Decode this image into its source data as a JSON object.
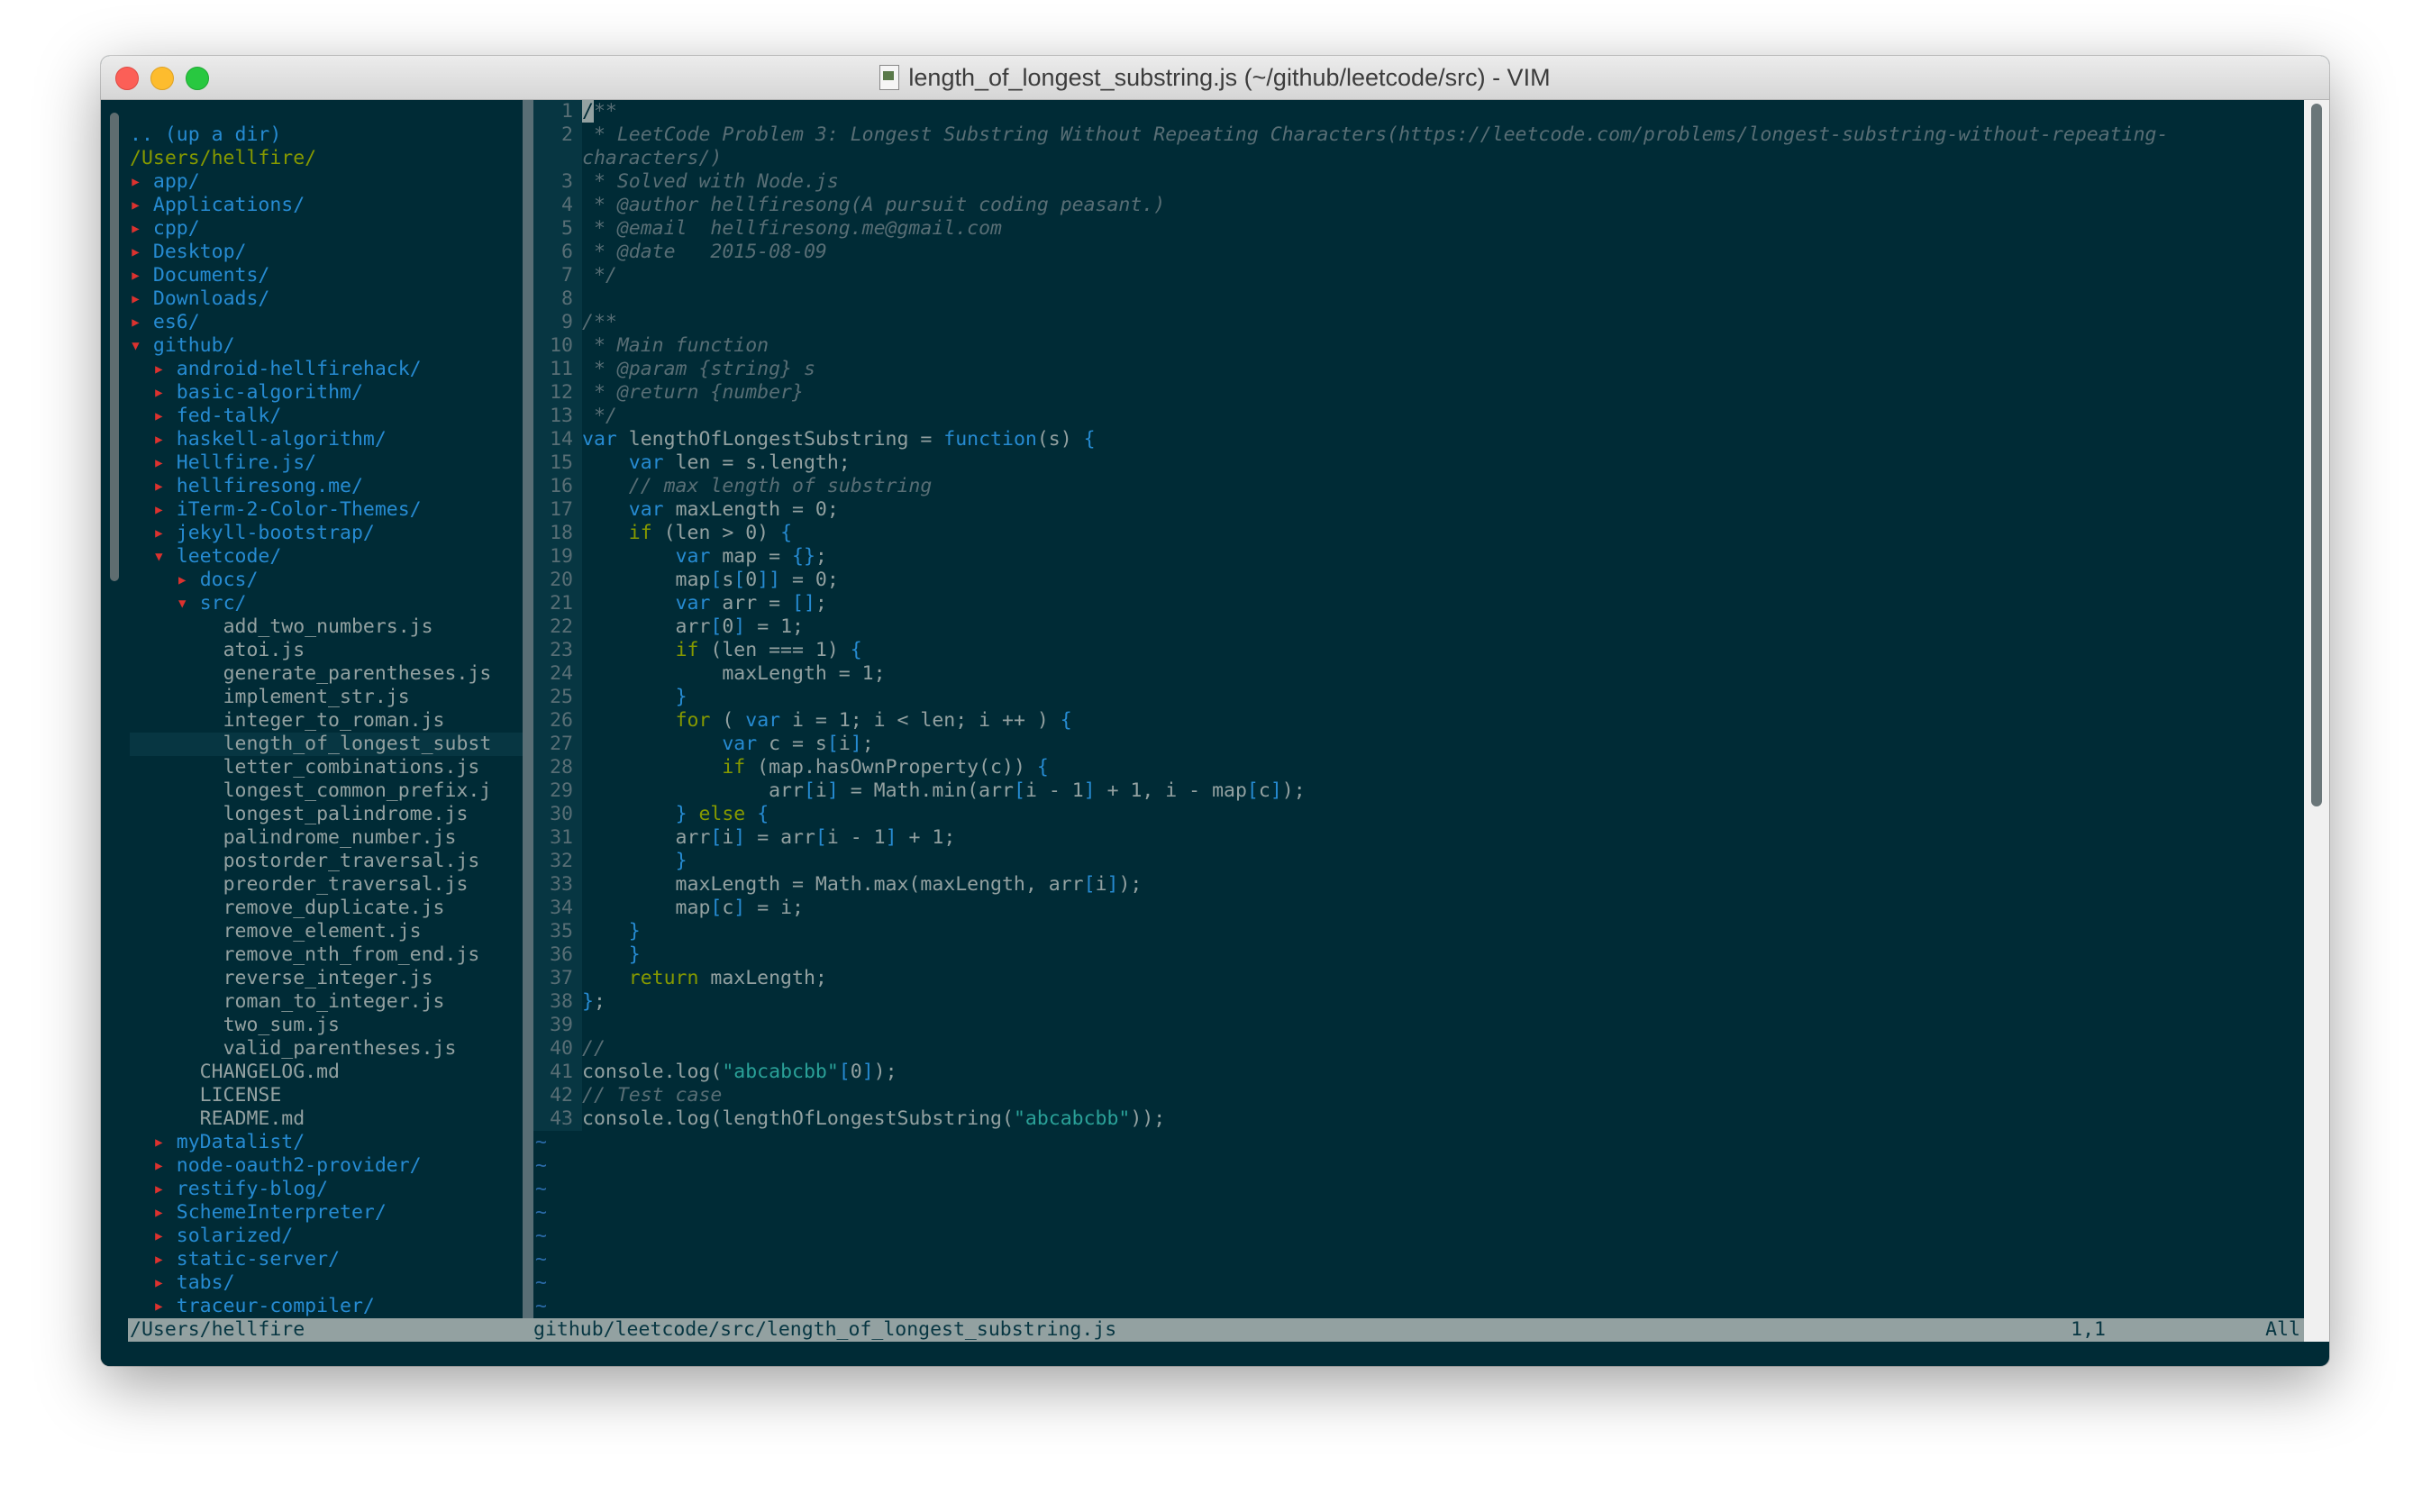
{
  "window": {
    "title": "length_of_longest_substring.js (~/github/leetcode/src) - VIM"
  },
  "tree": [
    {
      "depth": 0,
      "kind": "updir",
      "text": ".. (up a dir)"
    },
    {
      "depth": 0,
      "kind": "root",
      "text": "/Users/hellfire/"
    },
    {
      "depth": 0,
      "kind": "dir",
      "open": false,
      "text": "app/"
    },
    {
      "depth": 0,
      "kind": "dir",
      "open": false,
      "text": "Applications/"
    },
    {
      "depth": 0,
      "kind": "dir",
      "open": false,
      "text": "cpp/"
    },
    {
      "depth": 0,
      "kind": "dir",
      "open": false,
      "text": "Desktop/"
    },
    {
      "depth": 0,
      "kind": "dir",
      "open": false,
      "text": "Documents/"
    },
    {
      "depth": 0,
      "kind": "dir",
      "open": false,
      "text": "Downloads/"
    },
    {
      "depth": 0,
      "kind": "dir",
      "open": false,
      "text": "es6/"
    },
    {
      "depth": 0,
      "kind": "dir",
      "open": true,
      "text": "github/"
    },
    {
      "depth": 1,
      "kind": "dir",
      "open": false,
      "text": "android-hellfirehack/"
    },
    {
      "depth": 1,
      "kind": "dir",
      "open": false,
      "text": "basic-algorithm/"
    },
    {
      "depth": 1,
      "kind": "dir",
      "open": false,
      "text": "fed-talk/"
    },
    {
      "depth": 1,
      "kind": "dir",
      "open": false,
      "text": "haskell-algorithm/"
    },
    {
      "depth": 1,
      "kind": "dir",
      "open": false,
      "text": "Hellfire.js/"
    },
    {
      "depth": 1,
      "kind": "dir",
      "open": false,
      "text": "hellfiresong.me/"
    },
    {
      "depth": 1,
      "kind": "dir",
      "open": false,
      "text": "iTerm-2-Color-Themes/"
    },
    {
      "depth": 1,
      "kind": "dir",
      "open": false,
      "text": "jekyll-bootstrap/"
    },
    {
      "depth": 1,
      "kind": "dir",
      "open": true,
      "text": "leetcode/"
    },
    {
      "depth": 2,
      "kind": "dir",
      "open": false,
      "text": "docs/"
    },
    {
      "depth": 2,
      "kind": "dir",
      "open": true,
      "text": "src/"
    },
    {
      "depth": 3,
      "kind": "file",
      "text": "add_two_numbers.js"
    },
    {
      "depth": 3,
      "kind": "file",
      "text": "atoi.js"
    },
    {
      "depth": 3,
      "kind": "file",
      "text": "generate_parentheses.js"
    },
    {
      "depth": 3,
      "kind": "file",
      "text": "implement_str.js"
    },
    {
      "depth": 3,
      "kind": "file",
      "text": "integer_to_roman.js"
    },
    {
      "depth": 3,
      "kind": "file",
      "current": true,
      "text": "length_of_longest_subst"
    },
    {
      "depth": 3,
      "kind": "file",
      "text": "letter_combinations.js"
    },
    {
      "depth": 3,
      "kind": "file",
      "text": "longest_common_prefix.j"
    },
    {
      "depth": 3,
      "kind": "file",
      "text": "longest_palindrome.js"
    },
    {
      "depth": 3,
      "kind": "file",
      "text": "palindrome_number.js"
    },
    {
      "depth": 3,
      "kind": "file",
      "text": "postorder_traversal.js"
    },
    {
      "depth": 3,
      "kind": "file",
      "text": "preorder_traversal.js"
    },
    {
      "depth": 3,
      "kind": "file",
      "text": "remove_duplicate.js"
    },
    {
      "depth": 3,
      "kind": "file",
      "text": "remove_element.js"
    },
    {
      "depth": 3,
      "kind": "file",
      "text": "remove_nth_from_end.js"
    },
    {
      "depth": 3,
      "kind": "file",
      "text": "reverse_integer.js"
    },
    {
      "depth": 3,
      "kind": "file",
      "text": "roman_to_integer.js"
    },
    {
      "depth": 3,
      "kind": "file",
      "text": "two_sum.js"
    },
    {
      "depth": 3,
      "kind": "file",
      "text": "valid_parentheses.js"
    },
    {
      "depth": 2,
      "kind": "file",
      "text": "CHANGELOG.md"
    },
    {
      "depth": 2,
      "kind": "file",
      "text": "LICENSE"
    },
    {
      "depth": 2,
      "kind": "file",
      "text": "README.md"
    },
    {
      "depth": 1,
      "kind": "dir",
      "open": false,
      "text": "myDatalist/"
    },
    {
      "depth": 1,
      "kind": "dir",
      "open": false,
      "text": "node-oauth2-provider/"
    },
    {
      "depth": 1,
      "kind": "dir",
      "open": false,
      "text": "restify-blog/"
    },
    {
      "depth": 1,
      "kind": "dir",
      "open": false,
      "text": "SchemeInterpreter/"
    },
    {
      "depth": 1,
      "kind": "dir",
      "open": false,
      "text": "solarized/"
    },
    {
      "depth": 1,
      "kind": "dir",
      "open": false,
      "text": "static-server/"
    },
    {
      "depth": 1,
      "kind": "dir",
      "open": false,
      "text": "tabs/"
    },
    {
      "depth": 1,
      "kind": "dir",
      "open": false,
      "text": "traceur-compiler/"
    }
  ],
  "icons": {
    "closed": "▸",
    "open": "▾",
    "tilde": "~"
  },
  "code": [
    {
      "n": "1",
      "tokens": [
        {
          "t": "/",
          "c": "cursor"
        },
        {
          "t": "**",
          "c": "c-comment"
        }
      ]
    },
    {
      "n": "2",
      "tokens": [
        {
          "t": " * LeetCode Problem 3: Longest Substring Without Repeating Characters(https://leetcode.com/problems/longest-substring-without-repeating-",
          "c": "c-comment"
        }
      ]
    },
    {
      "n": "",
      "tokens": [
        {
          "t": "characters/)",
          "c": "c-comment"
        }
      ]
    },
    {
      "n": "3",
      "tokens": [
        {
          "t": " * Solved with Node.js",
          "c": "c-comment"
        }
      ]
    },
    {
      "n": "4",
      "tokens": [
        {
          "t": " * @author hellfiresong(A pursuit coding peasant.)",
          "c": "c-comment"
        }
      ]
    },
    {
      "n": "5",
      "tokens": [
        {
          "t": " * @email  hellfiresong.me@gmail.com",
          "c": "c-comment"
        }
      ]
    },
    {
      "n": "6",
      "tokens": [
        {
          "t": " * @date   2015-08-09",
          "c": "c-comment"
        }
      ]
    },
    {
      "n": "7",
      "tokens": [
        {
          "t": " */",
          "c": "c-comment"
        }
      ]
    },
    {
      "n": "8",
      "tokens": []
    },
    {
      "n": "9",
      "tokens": [
        {
          "t": "/**",
          "c": "c-comment"
        }
      ]
    },
    {
      "n": "10",
      "tokens": [
        {
          "t": " * Main function",
          "c": "c-comment"
        }
      ]
    },
    {
      "n": "11",
      "tokens": [
        {
          "t": " * @param {string} s",
          "c": "c-comment"
        }
      ]
    },
    {
      "n": "12",
      "tokens": [
        {
          "t": " * @return {number}",
          "c": "c-comment"
        }
      ]
    },
    {
      "n": "13",
      "tokens": [
        {
          "t": " */",
          "c": "c-comment"
        }
      ]
    },
    {
      "n": "14",
      "tokens": [
        {
          "t": "var",
          "c": "c-kw"
        },
        {
          "t": " lengthOfLongestSubstring = ",
          "c": "c-text"
        },
        {
          "t": "function",
          "c": "c-kw"
        },
        {
          "t": "(s) ",
          "c": "c-text"
        },
        {
          "t": "{",
          "c": "c-brace"
        }
      ]
    },
    {
      "n": "15",
      "tokens": [
        {
          "t": "    ",
          "c": "c-text"
        },
        {
          "t": "var",
          "c": "c-kw"
        },
        {
          "t": " len = s.length;",
          "c": "c-text"
        }
      ]
    },
    {
      "n": "16",
      "tokens": [
        {
          "t": "    // max length of substring",
          "c": "c-comment"
        }
      ]
    },
    {
      "n": "17",
      "tokens": [
        {
          "t": "    ",
          "c": "c-text"
        },
        {
          "t": "var",
          "c": "c-kw"
        },
        {
          "t": " maxLength = 0;",
          "c": "c-text"
        }
      ]
    },
    {
      "n": "18",
      "tokens": [
        {
          "t": "    ",
          "c": "c-text"
        },
        {
          "t": "if",
          "c": "c-cond"
        },
        {
          "t": " (len > 0) ",
          "c": "c-text"
        },
        {
          "t": "{",
          "c": "c-brace"
        }
      ]
    },
    {
      "n": "19",
      "tokens": [
        {
          "t": "        ",
          "c": "c-text"
        },
        {
          "t": "var",
          "c": "c-kw"
        },
        {
          "t": " map = ",
          "c": "c-text"
        },
        {
          "t": "{}",
          "c": "c-brace"
        },
        {
          "t": ";",
          "c": "c-text"
        }
      ]
    },
    {
      "n": "20",
      "tokens": [
        {
          "t": "        map",
          "c": "c-text"
        },
        {
          "t": "[",
          "c": "c-brace"
        },
        {
          "t": "s",
          "c": "c-text"
        },
        {
          "t": "[",
          "c": "c-brace"
        },
        {
          "t": "0",
          "c": "c-text"
        },
        {
          "t": "]]",
          "c": "c-brace"
        },
        {
          "t": " = 0;",
          "c": "c-text"
        }
      ]
    },
    {
      "n": "21",
      "tokens": [
        {
          "t": "        ",
          "c": "c-text"
        },
        {
          "t": "var",
          "c": "c-kw"
        },
        {
          "t": " arr = ",
          "c": "c-text"
        },
        {
          "t": "[]",
          "c": "c-brace"
        },
        {
          "t": ";",
          "c": "c-text"
        }
      ]
    },
    {
      "n": "22",
      "tokens": [
        {
          "t": "        arr",
          "c": "c-text"
        },
        {
          "t": "[",
          "c": "c-brace"
        },
        {
          "t": "0",
          "c": "c-text"
        },
        {
          "t": "]",
          "c": "c-brace"
        },
        {
          "t": " = 1;",
          "c": "c-text"
        }
      ]
    },
    {
      "n": "23",
      "tokens": [
        {
          "t": "        ",
          "c": "c-text"
        },
        {
          "t": "if",
          "c": "c-cond"
        },
        {
          "t": " (len === 1) ",
          "c": "c-text"
        },
        {
          "t": "{",
          "c": "c-brace"
        }
      ]
    },
    {
      "n": "24",
      "tokens": [
        {
          "t": "            maxLength = 1;",
          "c": "c-text"
        }
      ]
    },
    {
      "n": "25",
      "tokens": [
        {
          "t": "        ",
          "c": "c-text"
        },
        {
          "t": "}",
          "c": "c-brace"
        }
      ]
    },
    {
      "n": "26",
      "tokens": [
        {
          "t": "        ",
          "c": "c-text"
        },
        {
          "t": "for",
          "c": "c-cond"
        },
        {
          "t": " ( ",
          "c": "c-text"
        },
        {
          "t": "var",
          "c": "c-kw"
        },
        {
          "t": " i = 1; i < len; i ++ ) ",
          "c": "c-text"
        },
        {
          "t": "{",
          "c": "c-brace"
        }
      ]
    },
    {
      "n": "27",
      "tokens": [
        {
          "t": "            ",
          "c": "c-text"
        },
        {
          "t": "var",
          "c": "c-kw"
        },
        {
          "t": " c = s",
          "c": "c-text"
        },
        {
          "t": "[",
          "c": "c-brace"
        },
        {
          "t": "i",
          "c": "c-text"
        },
        {
          "t": "]",
          "c": "c-brace"
        },
        {
          "t": ";",
          "c": "c-text"
        }
      ]
    },
    {
      "n": "28",
      "tokens": [
        {
          "t": "            ",
          "c": "c-text"
        },
        {
          "t": "if",
          "c": "c-cond"
        },
        {
          "t": " (map.hasOwnProperty(c)) ",
          "c": "c-text"
        },
        {
          "t": "{",
          "c": "c-brace"
        }
      ]
    },
    {
      "n": "29",
      "tokens": [
        {
          "t": "                arr",
          "c": "c-text"
        },
        {
          "t": "[",
          "c": "c-brace"
        },
        {
          "t": "i",
          "c": "c-text"
        },
        {
          "t": "]",
          "c": "c-brace"
        },
        {
          "t": " = Math.min(arr",
          "c": "c-text"
        },
        {
          "t": "[",
          "c": "c-brace"
        },
        {
          "t": "i - 1",
          "c": "c-text"
        },
        {
          "t": "]",
          "c": "c-brace"
        },
        {
          "t": " + 1, i - map",
          "c": "c-text"
        },
        {
          "t": "[",
          "c": "c-brace"
        },
        {
          "t": "c",
          "c": "c-text"
        },
        {
          "t": "]",
          "c": "c-brace"
        },
        {
          "t": ");",
          "c": "c-text"
        }
      ]
    },
    {
      "n": "30",
      "tokens": [
        {
          "t": "        ",
          "c": "c-text"
        },
        {
          "t": "}",
          "c": "c-brace"
        },
        {
          "t": " ",
          "c": "c-text"
        },
        {
          "t": "else",
          "c": "c-cond"
        },
        {
          "t": " ",
          "c": "c-text"
        },
        {
          "t": "{",
          "c": "c-brace"
        }
      ]
    },
    {
      "n": "31",
      "tokens": [
        {
          "t": "        arr",
          "c": "c-text"
        },
        {
          "t": "[",
          "c": "c-brace"
        },
        {
          "t": "i",
          "c": "c-text"
        },
        {
          "t": "]",
          "c": "c-brace"
        },
        {
          "t": " = arr",
          "c": "c-text"
        },
        {
          "t": "[",
          "c": "c-brace"
        },
        {
          "t": "i - 1",
          "c": "c-text"
        },
        {
          "t": "]",
          "c": "c-brace"
        },
        {
          "t": " + 1;",
          "c": "c-text"
        }
      ]
    },
    {
      "n": "32",
      "tokens": [
        {
          "t": "        ",
          "c": "c-text"
        },
        {
          "t": "}",
          "c": "c-brace"
        }
      ]
    },
    {
      "n": "33",
      "tokens": [
        {
          "t": "        maxLength = Math.max(maxLength, arr",
          "c": "c-text"
        },
        {
          "t": "[",
          "c": "c-brace"
        },
        {
          "t": "i",
          "c": "c-text"
        },
        {
          "t": "]",
          "c": "c-brace"
        },
        {
          "t": ");",
          "c": "c-text"
        }
      ]
    },
    {
      "n": "34",
      "tokens": [
        {
          "t": "        map",
          "c": "c-text"
        },
        {
          "t": "[",
          "c": "c-brace"
        },
        {
          "t": "c",
          "c": "c-text"
        },
        {
          "t": "]",
          "c": "c-brace"
        },
        {
          "t": " = i;",
          "c": "c-text"
        }
      ]
    },
    {
      "n": "35",
      "tokens": [
        {
          "t": "    ",
          "c": "c-text"
        },
        {
          "t": "}",
          "c": "c-brace"
        }
      ]
    },
    {
      "n": "36",
      "tokens": [
        {
          "t": "    ",
          "c": "c-text"
        },
        {
          "t": "}",
          "c": "c-brace"
        }
      ]
    },
    {
      "n": "37",
      "tokens": [
        {
          "t": "    ",
          "c": "c-text"
        },
        {
          "t": "return",
          "c": "c-cond"
        },
        {
          "t": " maxLength;",
          "c": "c-text"
        }
      ]
    },
    {
      "n": "38",
      "tokens": [
        {
          "t": "}",
          "c": "c-brace"
        },
        {
          "t": ";",
          "c": "c-text"
        }
      ]
    },
    {
      "n": "39",
      "tokens": []
    },
    {
      "n": "40",
      "tokens": [
        {
          "t": "//",
          "c": "c-comment"
        }
      ]
    },
    {
      "n": "41",
      "tokens": [
        {
          "t": "console.log(",
          "c": "c-text"
        },
        {
          "t": "\"abcabcbb\"",
          "c": "c-str"
        },
        {
          "t": "[",
          "c": "c-brace"
        },
        {
          "t": "0",
          "c": "c-text"
        },
        {
          "t": "]",
          "c": "c-brace"
        },
        {
          "t": ");",
          "c": "c-text"
        }
      ]
    },
    {
      "n": "42",
      "tokens": [
        {
          "t": "// Test case",
          "c": "c-comment"
        }
      ]
    },
    {
      "n": "43",
      "tokens": [
        {
          "t": "console.log(lengthOfLongestSubstring(",
          "c": "c-text"
        },
        {
          "t": "\"abcabcbb\"",
          "c": "c-str"
        },
        {
          "t": "));",
          "c": "c-text"
        }
      ]
    }
  ],
  "tilde_rows": 8,
  "status": {
    "tree_path": "/Users/hellfire",
    "file": "github/leetcode/src/length_of_longest_substring.js",
    "position": "1,1",
    "scroll": "All"
  }
}
